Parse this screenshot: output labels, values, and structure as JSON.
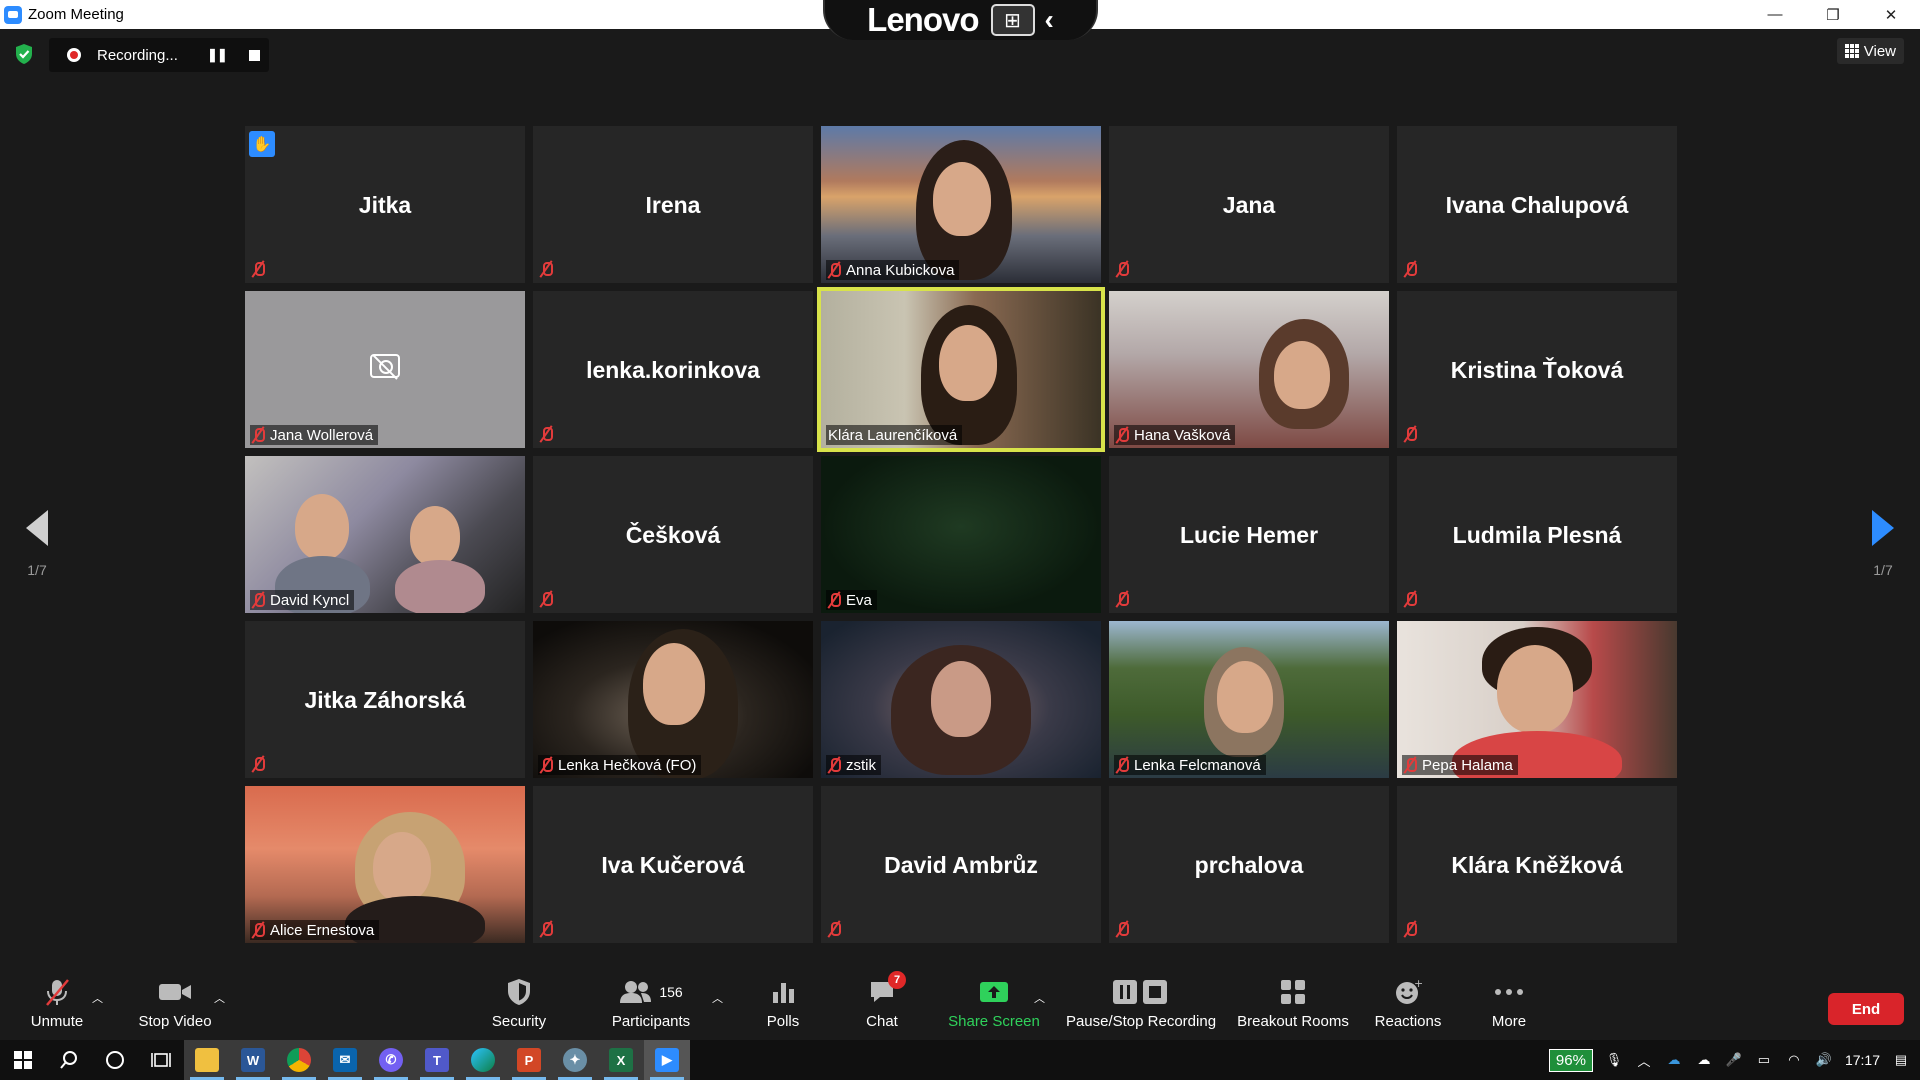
{
  "window": {
    "title": "Zoom Meeting",
    "minimize": "—",
    "restore": "❐",
    "close": "✕"
  },
  "lenovo_bar": {
    "brand": "Lenovo",
    "pin_glyph": "⊞",
    "collapse_glyph": "‹"
  },
  "recording": {
    "label": "Recording...",
    "pause_glyph": "❚❚"
  },
  "view_button": {
    "label": "View"
  },
  "pagination": {
    "prev_label": "1/7",
    "next_label": "1/7"
  },
  "participants": [
    {
      "name": "Jitka",
      "video": false,
      "hand_raised": true
    },
    {
      "name": "Irena",
      "video": false
    },
    {
      "name": "Anna Kubickova",
      "video": true
    },
    {
      "name": "Jana",
      "video": false
    },
    {
      "name": "Ivana Chalupová",
      "video": false
    },
    {
      "name": "Jana Wollerová",
      "video": false,
      "camera_blocked": true
    },
    {
      "name": "lenka.korinkova",
      "video": false
    },
    {
      "name": "Klára Laurenčíková",
      "video": true,
      "active_speaker": true,
      "unmuted": true
    },
    {
      "name": "Hana Vašková",
      "video": true
    },
    {
      "name": "Kristina Ťoková",
      "video": false
    },
    {
      "name": "David Kyncl",
      "video": true
    },
    {
      "name": "Češková",
      "video": false
    },
    {
      "name": "Eva",
      "video": true
    },
    {
      "name": "Lucie Hemer",
      "video": false
    },
    {
      "name": "Ludmila Plesná",
      "video": false
    },
    {
      "name": "Jitka Záhorská",
      "video": false
    },
    {
      "name": "Lenka Hečková (FO)",
      "video": true
    },
    {
      "name": "zstik",
      "video": true
    },
    {
      "name": "Lenka Felcmanová",
      "video": true
    },
    {
      "name": "Pepa Halama",
      "video": true
    },
    {
      "name": "Alice Ernestova",
      "video": true
    },
    {
      "name": "Iva Kučerová",
      "video": false
    },
    {
      "name": "David Ambrůz",
      "video": false
    },
    {
      "name": "prchalova",
      "video": false
    },
    {
      "name": "Klára Kněžková",
      "video": false
    }
  ],
  "toolbar": {
    "unmute": "Unmute",
    "stop_video": "Stop Video",
    "security": "Security",
    "participants": "Participants",
    "participants_count": "156",
    "polls": "Polls",
    "chat": "Chat",
    "chat_badge": "7",
    "share_screen": "Share Screen",
    "pause_stop_recording": "Pause/Stop Recording",
    "breakout_rooms": "Breakout Rooms",
    "reactions": "Reactions",
    "more": "More",
    "end": "End"
  },
  "taskbar": {
    "apps": [
      "start",
      "search",
      "cortana",
      "task-view",
      "file-explorer",
      "word",
      "chrome",
      "mail",
      "viber",
      "teams",
      "edge",
      "powerpoint",
      "app-bird",
      "excel",
      "zoom"
    ],
    "app_labels": {
      "word": "W",
      "powerpoint": "P",
      "excel": "X",
      "teams": "T"
    },
    "battery": "96%",
    "time": "17:17"
  },
  "colors": {
    "accent": "#2d8cff",
    "active_speaker": "#d8e34a",
    "mute_red": "#e23b3b",
    "end_red": "#d9242a",
    "share_green": "#2fd15b"
  }
}
